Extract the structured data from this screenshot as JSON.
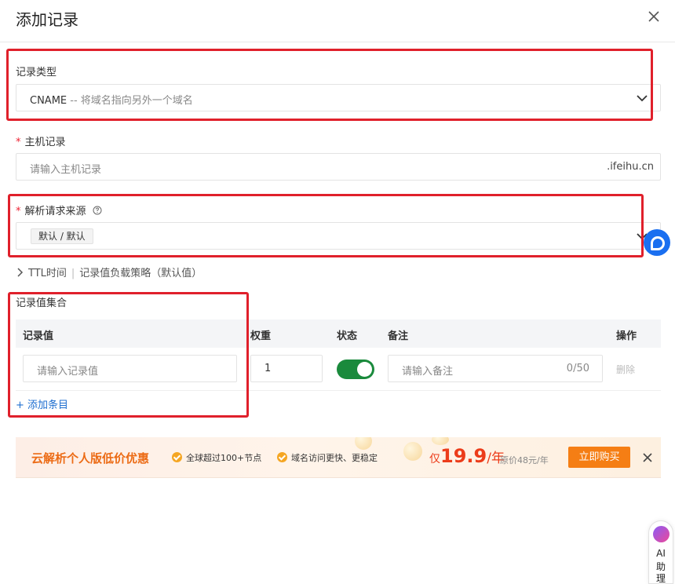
{
  "dialog": {
    "title": "添加记录"
  },
  "record_type": {
    "label": "记录类型",
    "value_main": "CNAME",
    "value_desc": "-- 将域名指向另外一个域名"
  },
  "host_record": {
    "required_mark": "*",
    "label": "主机记录",
    "placeholder": "请输入主机记录",
    "suffix": ".ifeihu.cn"
  },
  "resolve_source": {
    "required_mark": "*",
    "label": "解析请求来源",
    "help_icon": "question-circle-icon",
    "tag": "默认 / 默认"
  },
  "advanced": {
    "ttl": "TTL时间",
    "separator": "|",
    "policy": "记录值负载策略（默认值）"
  },
  "record_set": {
    "label": "记录值集合",
    "columns": {
      "value": "记录值",
      "weight": "权重",
      "status": "状态",
      "note": "备注",
      "action": "操作"
    },
    "row": {
      "value_placeholder": "请输入记录值",
      "weight": "1",
      "status_on": true,
      "note_placeholder": "请输入备注",
      "note_count": "0/50",
      "delete": "删除"
    },
    "add_item": "+ 添加条目"
  },
  "promo": {
    "title": "云解析个人版低价优惠",
    "feature_1": "全球超过100+节点",
    "feature_2": "域名访问更快、更稳定",
    "price_prefix": "仅",
    "price": "19.9",
    "price_unit": "/年",
    "original": "原价48元/年",
    "buy": "立即购买"
  },
  "ai_assistant": {
    "line1": "AI",
    "line2": "助",
    "line3": "理"
  },
  "colors": {
    "highlight_box": "#e0202b",
    "toggle_on": "#1a8a3c",
    "link": "#1f6fd0",
    "promo_orange": "#f57e14",
    "price_red": "#ec3c1a"
  }
}
